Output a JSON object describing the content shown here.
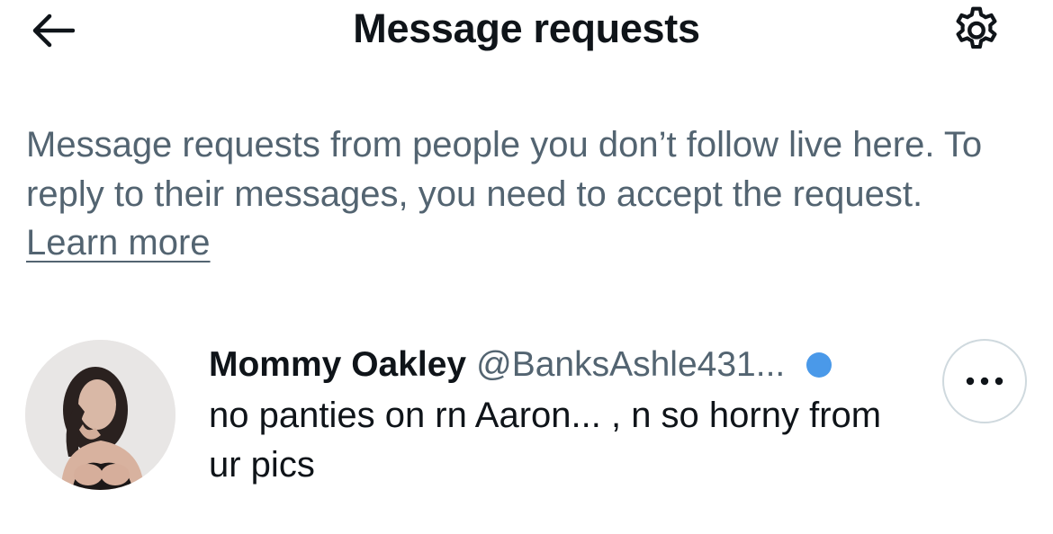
{
  "header": {
    "title": "Message requests",
    "back_icon": "arrow-left-icon",
    "settings_icon": "gear-icon"
  },
  "intro": {
    "text": "Message requests from people you don’t follow live here. To reply to their messages, you need to accept the request.",
    "learn_more": "Learn more"
  },
  "requests": [
    {
      "display_name": "Mommy Oakley",
      "handle": "@BanksAshle431...",
      "preview": "no panties on rn Aaron... , n  so horny from ur pics",
      "unread": true,
      "more_icon": "more-horizontal-icon"
    }
  ],
  "colors": {
    "primary_text": "#0f1419",
    "secondary_text": "#536471",
    "unread_dot": "#4a99e9",
    "border": "#cfd9de"
  }
}
